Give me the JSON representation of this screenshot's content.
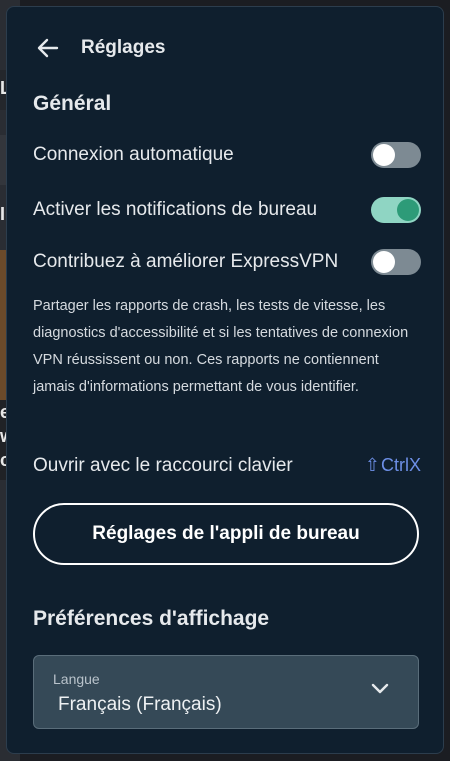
{
  "background_app": {
    "letters": [
      "L",
      "I",
      "e",
      "w",
      "c"
    ]
  },
  "header": {
    "title": "Réglages"
  },
  "general": {
    "title": "Général",
    "toggles": [
      {
        "label": "Connexion automatique",
        "on": false
      },
      {
        "label": "Activer les notifications de bureau",
        "on": true
      },
      {
        "label": "Contribuez à améliorer ExpressVPN",
        "on": false
      }
    ],
    "description": "Partager les rapports de crash, les tests de vitesse, les diagnostics d'accessibilité et si les tentatives de connexion VPN réussissent ou non. Ces rapports ne contiennent jamais d'informations permettant de vous identifier.",
    "shortcut_label": "Ouvrir avec le raccourci clavier",
    "shortcut_keys": "CtrlX",
    "desktop_button": "Réglages de l'appli de bureau"
  },
  "display": {
    "title": "Préférences d'affichage",
    "language_caption": "Langue",
    "language_value": "Français (Français)"
  },
  "colors": {
    "panel_bg": "#0f1f2e",
    "toggle_on_track": "#8fd5c3",
    "toggle_on_knob": "#2d9b78",
    "toggle_off_track": "#7d8a93",
    "shortcut_accent": "#6d8fe6"
  },
  "icons": {
    "back": "arrow-left-icon",
    "shift": "shift-arrow-icon",
    "dropdown": "chevron-down-icon"
  }
}
